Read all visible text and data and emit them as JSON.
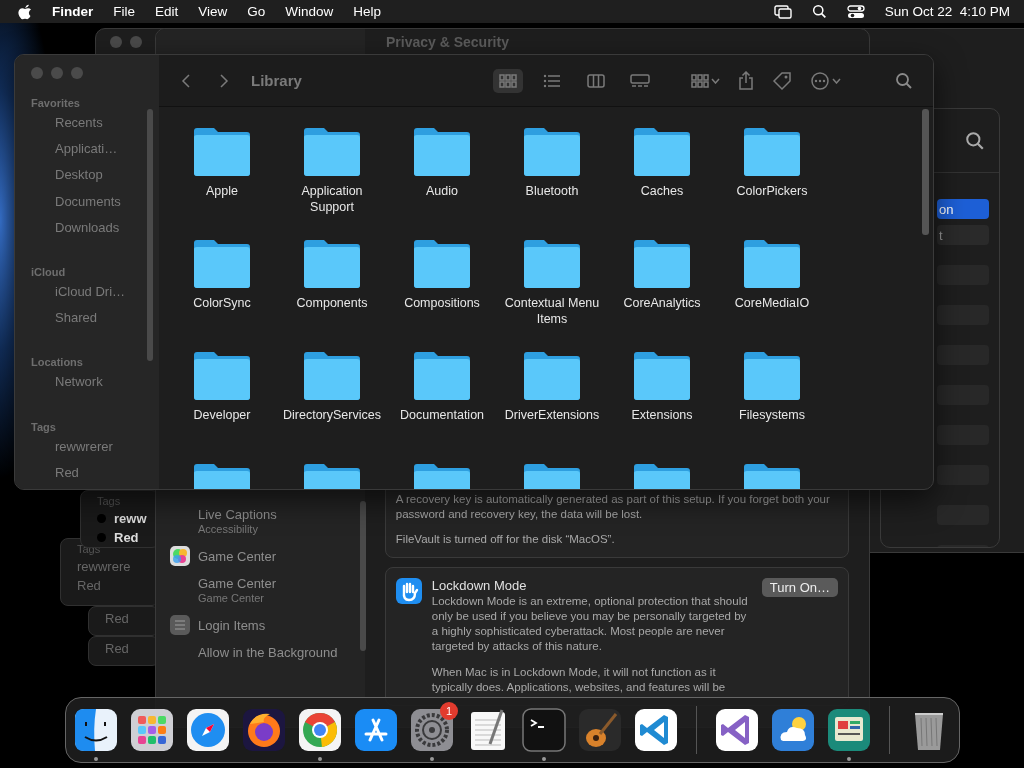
{
  "menu_bar": {
    "app": "Finder",
    "menus": [
      "File",
      "Edit",
      "View",
      "Go",
      "Window",
      "Help"
    ],
    "clock": "Sun Oct 22  4:10 PM"
  },
  "back_window": {
    "title": "Privacy & Security"
  },
  "settings_window": {
    "sidebar": [
      {
        "kind": "entry",
        "title": "Live Captions",
        "subtitle": "Accessibility"
      },
      {
        "kind": "colorful-category",
        "title": "Game Center"
      },
      {
        "kind": "entry",
        "title": "Game Center",
        "subtitle": "Game Center"
      },
      {
        "kind": "list-category",
        "title": "Login Items"
      },
      {
        "kind": "entry",
        "title": "Allow in the Background"
      }
    ],
    "filevault": {
      "warning": "A recovery key is automatically generated as part of this setup. If you forget both your password and recovery key, the data will be lost.",
      "status": "FileVault is turned off for the disk “MacOS”."
    },
    "lockdown": {
      "title": "Lockdown Mode",
      "description": "Lockdown Mode is an extreme, optional protection that should only be used if you believe you may be personally targeted by a highly sophisticated cyberattack. Most people are never targeted by attacks of this nature.",
      "details": "When Mac is in Lockdown Mode, it will not function as it typically does. Applications, websites, and features will be",
      "button": "Turn On…"
    }
  },
  "side_window": {
    "rows": [
      {
        "label": "on",
        "selected": true
      },
      {
        "label": "t",
        "selected": false
      }
    ]
  },
  "ghost_panels": [
    {
      "heading": "Tags",
      "items": [
        "reww",
        "Red"
      ]
    },
    {
      "heading": "Tags",
      "items": [
        "rewwrere",
        "Red"
      ]
    },
    {
      "items": [
        "Red"
      ]
    },
    {
      "items": [
        "Red"
      ]
    }
  ],
  "finder": {
    "title": "Library",
    "views": [
      {
        "kind": "icons",
        "selected": true
      },
      {
        "kind": "list",
        "selected": false
      },
      {
        "kind": "columns",
        "selected": false
      },
      {
        "kind": "gallery",
        "selected": false
      }
    ],
    "sidebar": [
      {
        "heading": "Favorites",
        "items": [
          "Recents",
          "Applicati…",
          "Desktop",
          "Documents",
          "Downloads"
        ]
      },
      {
        "heading": "iCloud",
        "items": [
          "iCloud Dri…",
          "Shared"
        ]
      },
      {
        "heading": "Locations",
        "items": [
          "Network"
        ]
      },
      {
        "heading": "Tags",
        "items": [
          "rewwrerer",
          "Red"
        ]
      }
    ],
    "folders": [
      "Apple",
      "Application Support",
      "Audio",
      "Bluetooth",
      "Caches",
      "ColorPickers",
      "ColorSync",
      "Components",
      "Compositions",
      "Contextual Menu Items",
      "CoreAnalytics",
      "CoreMediaIO",
      "Developer",
      "DirectoryServices",
      "Documentation",
      "DriverExtensions",
      "Extensions",
      "Filesystems"
    ]
  },
  "dock": {
    "sections": [
      {
        "items": [
          {
            "kind": "finder",
            "running": true
          },
          {
            "kind": "launchpad",
            "running": false
          },
          {
            "kind": "safari",
            "running": false
          },
          {
            "kind": "firefox",
            "running": false
          },
          {
            "kind": "chrome",
            "running": true
          },
          {
            "kind": "appstore",
            "running": false
          },
          {
            "kind": "settings",
            "running": true,
            "badge": "1"
          },
          {
            "kind": "textedit",
            "running": false
          },
          {
            "kind": "terminal",
            "running": true
          },
          {
            "kind": "garageband",
            "running": false
          },
          {
            "kind": "vscode",
            "running": false
          }
        ]
      },
      {
        "items": [
          {
            "kind": "visualstudio",
            "running": false
          },
          {
            "kind": "weather",
            "running": false
          },
          {
            "kind": "monitor",
            "running": true
          }
        ]
      },
      {
        "items": [
          {
            "kind": "trash",
            "running": false
          }
        ]
      }
    ]
  }
}
